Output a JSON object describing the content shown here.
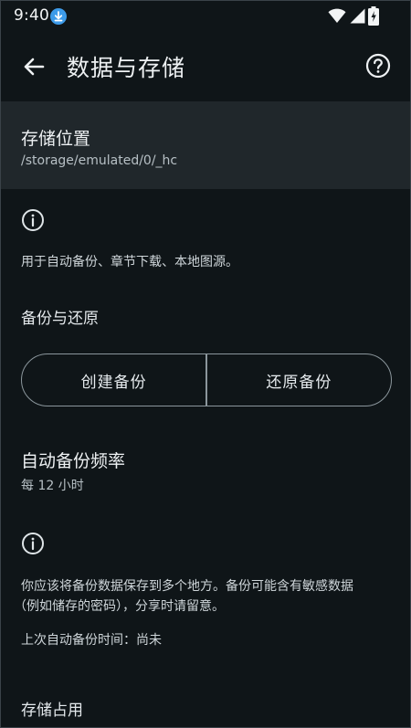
{
  "status_bar": {
    "time": "9:40",
    "icons": [
      "download-icon",
      "wifi-icon",
      "signal-icon",
      "battery-charging-icon"
    ]
  },
  "app_bar": {
    "title": "数据与存储",
    "back_icon": "arrow-left-icon",
    "help_icon": "help-circle-icon"
  },
  "storage_location": {
    "title": "存储位置",
    "path": "/storage/emulated/0/_hc"
  },
  "storage_info": {
    "icon": "info-icon",
    "text": "用于自动备份、章节下载、本地图源。"
  },
  "backup_restore": {
    "header": "备份与还原",
    "create_label": "创建备份",
    "restore_label": "还原备份"
  },
  "auto_backup": {
    "title": "自动备份频率",
    "value": "每 12 小时"
  },
  "backup_info": {
    "icon": "info-icon",
    "line1": "你应该将备份数据保存到多个地方。备份可能含有敏感数据",
    "line2": "（例如储存的密码），分享时请留意。",
    "last_backup": "上次自动备份时间：尚未"
  },
  "storage_usage": {
    "header": "存储占用"
  },
  "colors": {
    "background": "#0f1518",
    "highlight": "#20272b",
    "outline": "#8b969c",
    "download_badge": "#3d9be9"
  }
}
